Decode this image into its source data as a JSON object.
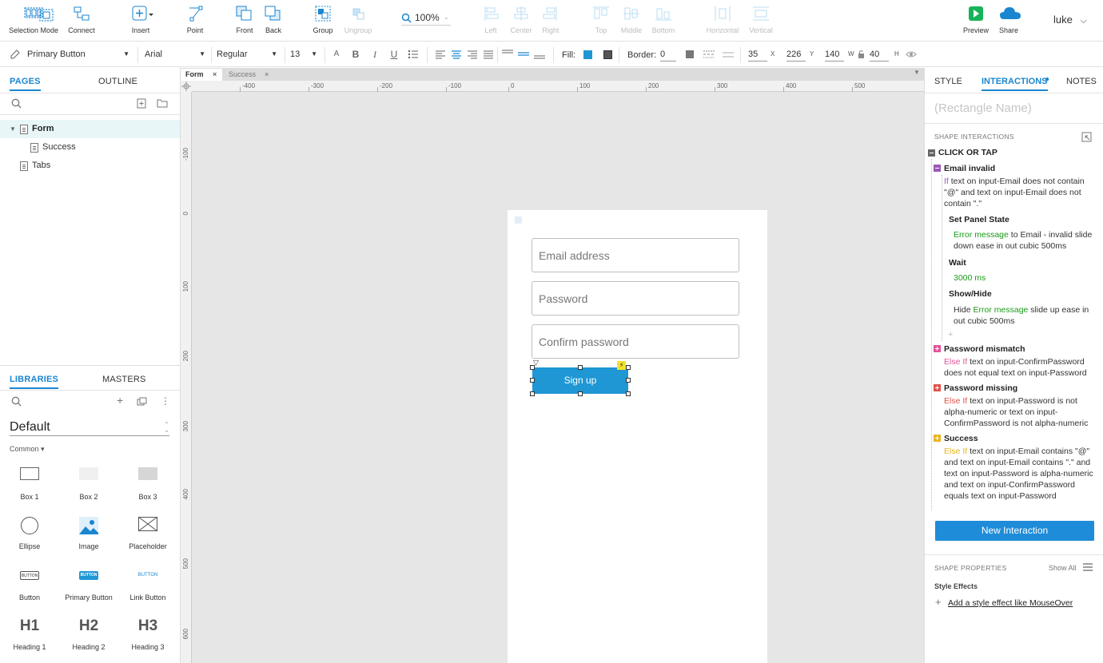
{
  "toolbar": {
    "selection_mode": "Selection Mode",
    "connect": "Connect",
    "insert": "Insert",
    "point": "Point",
    "front": "Front",
    "back": "Back",
    "group": "Group",
    "ungroup": "Ungroup",
    "zoom": "100%",
    "align_left": "Left",
    "align_center": "Center",
    "align_right": "Right",
    "align_top": "Top",
    "align_middle": "Middle",
    "align_bottom": "Bottom",
    "dist_horizontal": "Horizontal",
    "dist_vertical": "Vertical",
    "preview": "Preview",
    "share": "Share",
    "user": "luke"
  },
  "format": {
    "style": "Primary Button",
    "font": "Arial",
    "weight": "Regular",
    "size": "13",
    "fill_label": "Fill:",
    "border_label": "Border:",
    "border_value": "0",
    "x": "35",
    "y": "226",
    "w": "140",
    "h": "40",
    "x_unit": "X",
    "y_unit": "Y",
    "w_unit": "W",
    "h_unit": "H"
  },
  "left": {
    "tab_pages": "PAGES",
    "tab_outline": "OUTLINE",
    "pages": [
      "Form",
      "Success",
      "Tabs"
    ],
    "tab_libraries": "LIBRARIES",
    "tab_masters": "MASTERS",
    "library_name": "Default",
    "library_group": "Common ▾",
    "widgets": [
      "Box 1",
      "Box 2",
      "Box 3",
      "Ellipse",
      "Image",
      "Placeholder",
      "Button",
      "Primary Button",
      "Link Button",
      "Heading 1",
      "Heading 2",
      "Heading 3"
    ],
    "h1": "H1",
    "h2": "H2",
    "h3": "H3",
    "btn_thumb": "BUTTON"
  },
  "canvas": {
    "doc_tabs": [
      "Form",
      "Success"
    ],
    "hruler": [
      "-400",
      "-300",
      "-200",
      "-100",
      "0",
      "100",
      "200",
      "300",
      "400",
      "500"
    ],
    "vruler": [
      "-100",
      "0",
      "100",
      "200",
      "300",
      "400",
      "500",
      "600"
    ],
    "email_placeholder": "Email address",
    "password_placeholder": "Password",
    "confirm_placeholder": "Confirm password",
    "signup_label": "Sign up"
  },
  "right": {
    "tab_style": "STYLE",
    "tab_interactions": "INTERACTIONS",
    "tab_notes": "NOTES",
    "shape_name_placeholder": "(Rectangle Name)",
    "shape_interactions": "SHAPE INTERACTIONS",
    "event": "CLICK OR TAP",
    "case1_name": "Email invalid",
    "case1_kw": "If",
    "case1_cond": " text on input-Email does not contain \"@\" and text on input-Email does not contain \".\"",
    "action1": "Set Panel State",
    "action1_target": "Error message",
    "action1_rest": " to Email - invalid slide down ease in out cubic 500ms",
    "action2": "Wait",
    "action2_value": "3000 ms",
    "action3": "Show/Hide",
    "action3_pre": "Hide ",
    "action3_target": "Error message",
    "action3_rest": " slide up ease in out cubic 500ms",
    "case2_name": "Password mismatch",
    "case2_kw": "Else If",
    "case2_cond": " text on input-ConfirmPassword does not equal text on input-Password",
    "case3_name": "Password missing",
    "case3_kw": "Else If",
    "case3_cond": " text on input-Password is not alpha-numeric  or text on input-ConfirmPassword is not alpha-numeric",
    "case4_name": "Success",
    "case4_kw": "Else If",
    "case4_cond": " text on input-Email contains \"@\" and text on input-Email contains \".\" and text on input-Password is alpha-numeric  and text on input-ConfirmPassword equals text on input-Password",
    "new_interaction": "New Interaction",
    "shape_properties": "SHAPE PROPERTIES",
    "show_all": "Show All",
    "style_effects": "Style Effects",
    "add_style_effect": "Add a style effect like MouseOver"
  },
  "colors": {
    "accent": "#1a86d0",
    "button": "#1e97d4",
    "canvas_bg": "#e6e6e6",
    "highlight_row": "#e8f6f8"
  }
}
